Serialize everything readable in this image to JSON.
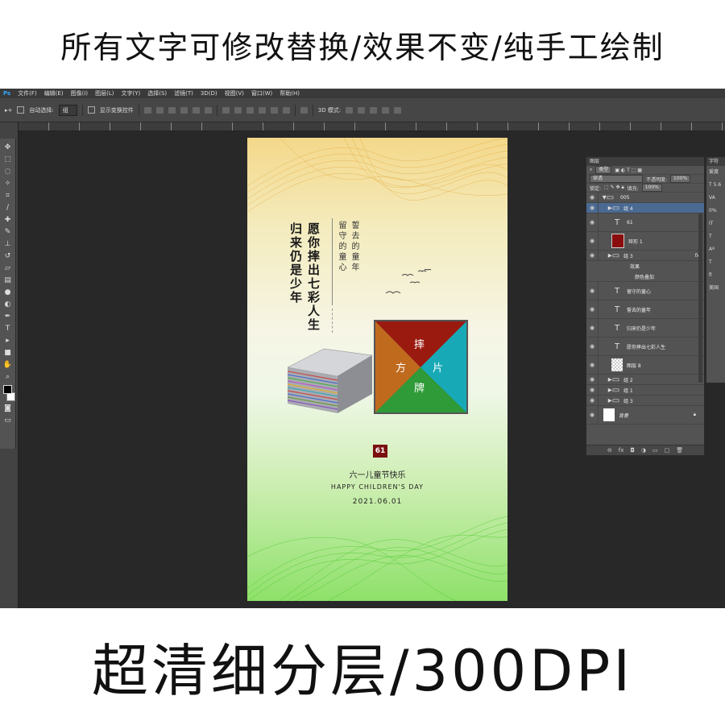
{
  "top_banner": {
    "text": "所有文字可修改替换/效果不变/纯手工绘制"
  },
  "bottom_banner": {
    "text": "超清细分层/300DPI"
  },
  "menubar": {
    "logo": "Ps",
    "items": [
      "文件(F)",
      "编辑(E)",
      "图像(I)",
      "图层(L)",
      "文字(Y)",
      "选择(S)",
      "滤镜(T)",
      "3D(D)",
      "视图(V)",
      "窗口(W)",
      "帮助(H)"
    ]
  },
  "options": {
    "auto_select_label": "自动选择:",
    "auto_select_value": "组",
    "transform_label": "显示变换控件",
    "mode_3d_label": "3D 模式:"
  },
  "poster": {
    "heading_col1": "归来仍是少年",
    "heading_col2": "愿你摔出七彩人生",
    "small_col1": "留守的童心",
    "small_col2": "誓去的童年",
    "tile_top": "摔",
    "tile_left": "方",
    "tile_right": "片",
    "tile_bottom": "牌",
    "badge": "61",
    "line1": "六一儿童节快乐",
    "line2": "HAPPY CHILDREN'S DAY",
    "line3": "2021.06.01",
    "colors": {
      "tile_top": "#9a1a10",
      "tile_left": "#c06a1e",
      "tile_right": "#18a9b7",
      "tile_bottom": "#2f9a38",
      "badge": "#7a1010"
    }
  },
  "layers_panel": {
    "tab": "图层",
    "filter_label": "类型",
    "blend_mode": "穿透",
    "opacity_label": "不透明度:",
    "opacity_value": "100%",
    "lock_label": "锁定:",
    "fill_label": "填充:",
    "fill_value": "100%",
    "layers": [
      {
        "name": "005",
        "kind": "folder-open"
      },
      {
        "name": "组 4",
        "kind": "folder"
      },
      {
        "name": "61",
        "kind": "text"
      },
      {
        "name": "矩形 1",
        "kind": "shape"
      },
      {
        "name": "组 3",
        "kind": "folder"
      },
      {
        "name": "效果",
        "kind": "effect"
      },
      {
        "name": "颜色叠加",
        "kind": "effect"
      },
      {
        "name": "留守的童心",
        "kind": "text"
      },
      {
        "name": "誓去的童年",
        "kind": "text"
      },
      {
        "name": "归来仍是少年",
        "kind": "text"
      },
      {
        "name": "愿你摔出七彩人生",
        "kind": "text"
      },
      {
        "name": "图层 8",
        "kind": "pixel"
      },
      {
        "name": "组 2",
        "kind": "folder"
      },
      {
        "name": "组 1",
        "kind": "folder"
      },
      {
        "name": "组 3",
        "kind": "folder"
      },
      {
        "name": "背景",
        "kind": "background"
      }
    ]
  },
  "character_panel": {
    "tab": "字符",
    "font": "爱度",
    "size": "5.6",
    "button": "美国"
  }
}
